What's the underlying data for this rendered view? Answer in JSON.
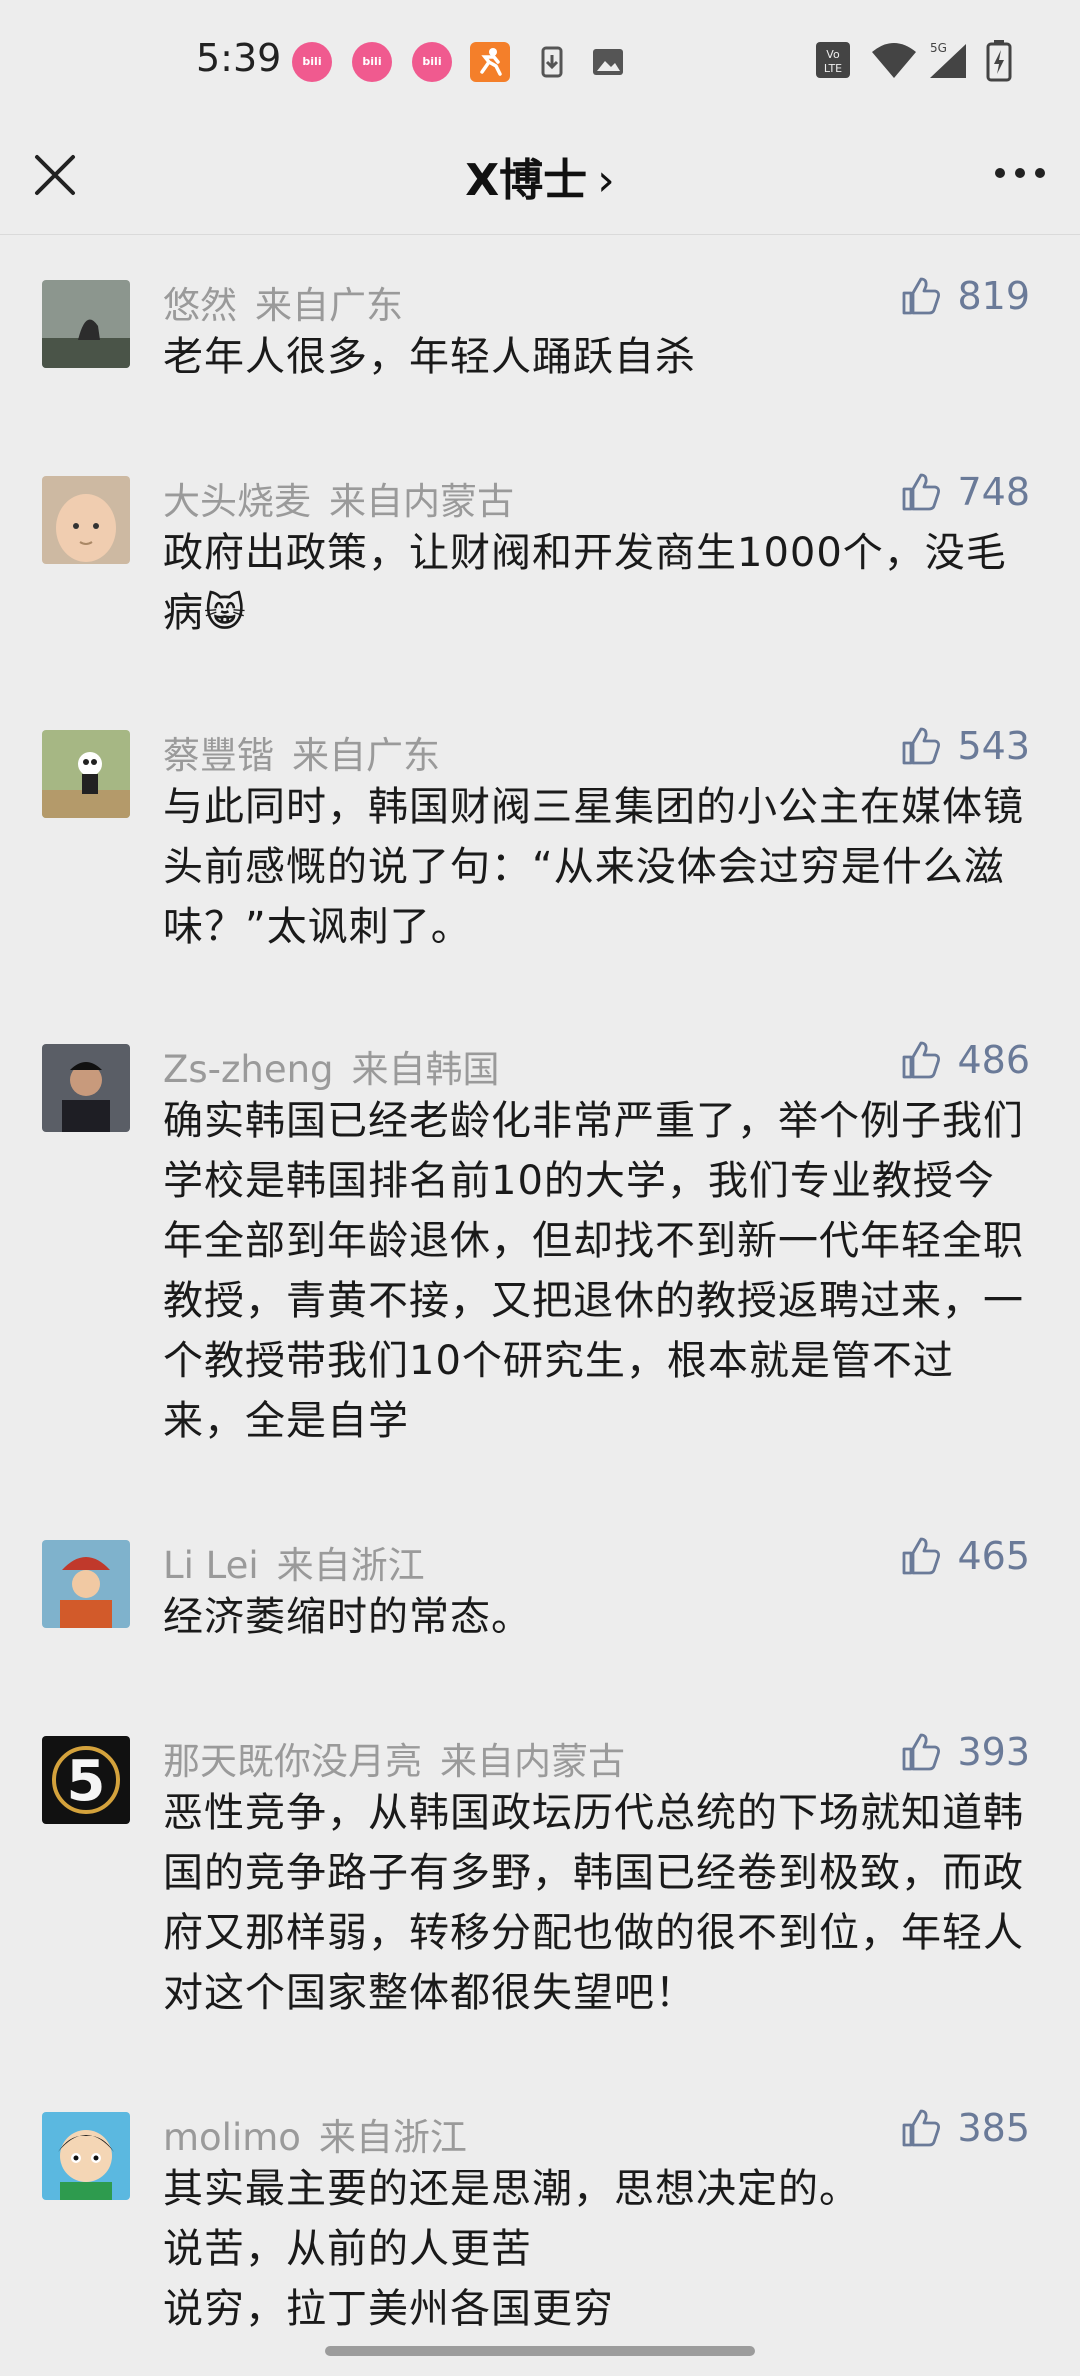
{
  "status_bar": {
    "time": "5:39",
    "notification_icons": [
      "bilibili-icon",
      "bilibili-icon",
      "bilibili-icon",
      "runner-app-icon",
      "download-icon",
      "image-icon"
    ],
    "volte_label": "VoLTE",
    "network_label": "5G"
  },
  "nav": {
    "title": "X博士",
    "chevron": "›"
  },
  "comments": [
    {
      "user": "悠然",
      "location": "来自广东",
      "likes": "819",
      "text": "老年人很多，年轻人踊跃自杀",
      "avatar_color": "#6f7b71"
    },
    {
      "user": "大头烧麦",
      "location": "来自内蒙古",
      "likes": "748",
      "text": "政府出政策，让财阀和开发商生1000个，没毛病",
      "emoji": "😸",
      "avatar_color": "#d8b89a"
    },
    {
      "user": "蔡豐锴",
      "location": "来自广东",
      "likes": "543",
      "text": "与此同时，韩国财阀三星集团的小公主在媒体镜头前感慨的说了句：“从来没体会过穷是什么滋味？”太讽刺了。",
      "avatar_color": "#8fa56b"
    },
    {
      "user": "Zs-zheng",
      "location": "来自韩国",
      "likes": "486",
      "text": "确实韩国已经老龄化非常严重了，举个例子我们学校是韩国排名前10的大学，我们专业教授今年全部到年龄退休，但却找不到新一代年轻全职教授，青黄不接，又把退休的教授返聘过来，一个教授带我们10个研究生，根本就是管不过来，全是自学",
      "avatar_color": "#3d3d45"
    },
    {
      "user": "Li Lei",
      "location": "来自浙江",
      "likes": "465",
      "text": "经济萎缩时的常态。",
      "avatar_color": "#c9894a"
    },
    {
      "user": "那天既你没月亮",
      "location": "来自内蒙古",
      "likes": "393",
      "text": "恶性竞争，从韩国政坛历代总统的下场就知道韩国的竞争路子有多野，韩国已经卷到极致，而政府又那样弱，转移分配也做的很不到位，年轻人对这个国家整体都很失望吧！",
      "avatar_text": "5",
      "avatar_color": "#1a1a1a"
    },
    {
      "user": "molimo",
      "location": "来自浙江",
      "likes": "385",
      "text": "其实最主要的还是思潮，思想决定的。\n说苦，从前的人更苦\n说穷，拉丁美州各国更穷",
      "avatar_color": "#4bb0d8"
    }
  ],
  "colors": {
    "background": "#ededed",
    "like_accent": "#6a7a98",
    "meta_text": "#9a9a9a",
    "body_text": "#1a1a1a"
  }
}
